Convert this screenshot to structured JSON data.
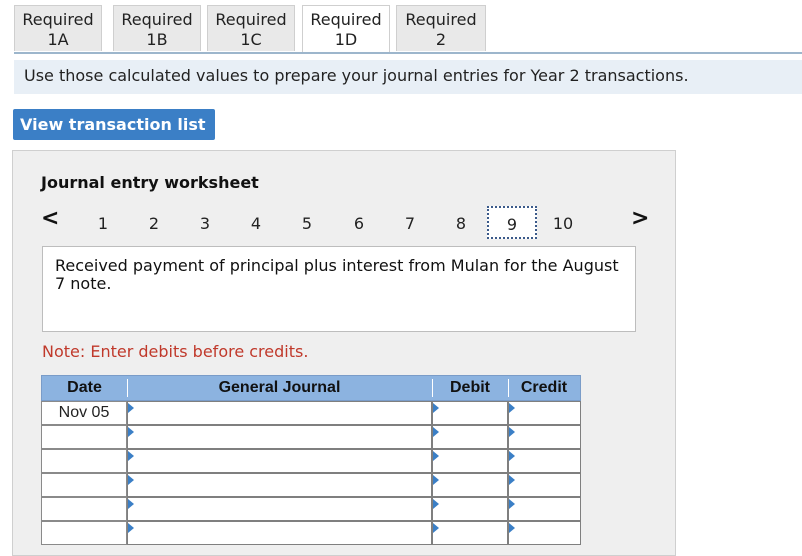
{
  "tabs": [
    {
      "line1": "Required",
      "line2": "1A",
      "active": false
    },
    {
      "line1": "Required",
      "line2": "1B",
      "active": false
    },
    {
      "line1": "Required",
      "line2": "1C",
      "active": false
    },
    {
      "line1": "Required",
      "line2": "1D",
      "active": true
    },
    {
      "line1": "Required",
      "line2": "2",
      "active": false
    }
  ],
  "instruction": "Use those calculated values to prepare your journal entries for Year 2 transactions.",
  "view_button": "View transaction list",
  "worksheet": {
    "title": "Journal entry worksheet",
    "prev_arrow": "<",
    "next_arrow": ">",
    "pages": [
      "1",
      "2",
      "3",
      "4",
      "5",
      "6",
      "7",
      "8",
      "9",
      "10"
    ],
    "active_page": "9",
    "description": "Received payment of principal plus interest from Mulan for the August 7 note.",
    "note": "Note: Enter debits before credits."
  },
  "journal": {
    "headers": {
      "date": "Date",
      "general_journal": "General Journal",
      "debit": "Debit",
      "credit": "Credit"
    },
    "rows": [
      {
        "date": "Nov 05",
        "account": "",
        "debit": "",
        "credit": ""
      },
      {
        "date": "",
        "account": "",
        "debit": "",
        "credit": ""
      },
      {
        "date": "",
        "account": "",
        "debit": "",
        "credit": ""
      },
      {
        "date": "",
        "account": "",
        "debit": "",
        "credit": ""
      },
      {
        "date": "",
        "account": "",
        "debit": "",
        "credit": ""
      },
      {
        "date": "",
        "account": "",
        "debit": "",
        "credit": ""
      }
    ]
  },
  "colors": {
    "accent": "#3b7fc6",
    "header_bg": "#8cb3e0",
    "note": "#c0392b",
    "instruction_bg": "#e8eff6"
  }
}
